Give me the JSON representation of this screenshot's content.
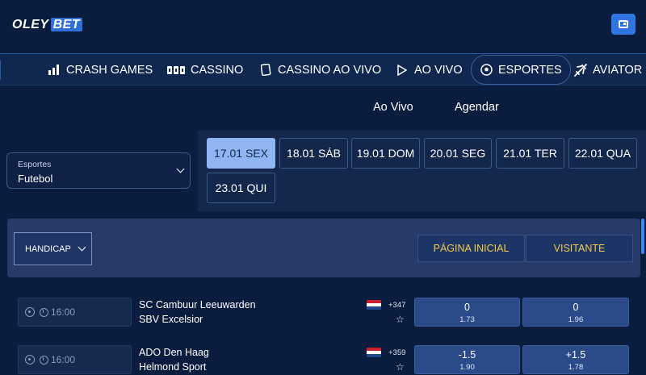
{
  "brand": {
    "logo_main": "OLEY",
    "logo_accent": "BET"
  },
  "icons": {
    "wallet": "wallet-icon",
    "crash_games": "bar-chart-icon",
    "cassino": "slot-reels-icon",
    "cassino_ao_vivo": "playing-card-icon",
    "ao_vivo": "play-icon",
    "esportes": "soccer-ball-icon",
    "aviator": "airplane-icon",
    "dropdown": "chevron-down-icon",
    "match_sport": "soccer-ball-icon",
    "match_time": "clock-icon",
    "favorite": "star-icon",
    "flag": "netherlands-flag-icon"
  },
  "nav": {
    "items": [
      {
        "label": "CRASH GAMES"
      },
      {
        "label": "CASSINO"
      },
      {
        "label": "CASSINO AO VIVO"
      },
      {
        "label": "AO VIVO"
      },
      {
        "label": "ESPORTES",
        "active": true
      },
      {
        "label": "AVIATOR"
      }
    ]
  },
  "subtabs": {
    "live": "Ao Vivo",
    "schedule": "Agendar"
  },
  "filter": {
    "label": "Esportes",
    "value": "Futebol"
  },
  "dates": [
    "17.01 SEX",
    "18.01 SÁB",
    "19.01 DOM",
    "20.01 SEG",
    "21.01 TER",
    "22.01 QUA",
    "23.01 QUI"
  ],
  "market": {
    "selected": "HANDICAP",
    "home_header": "PÁGINA INICIAL",
    "away_header": "VISITANTE"
  },
  "matches": [
    {
      "time": "16:00",
      "home": "SC Cambuur Leeuwarden",
      "away": "SBV Excelsior",
      "more_bets": "+347",
      "home_line": "0",
      "home_odds": "1.73",
      "away_line": "0",
      "away_odds": "1.96"
    },
    {
      "time": "16:00",
      "home": "ADO Den Haag",
      "away": "Helmond Sport",
      "more_bets": "+359",
      "home_line": "-1.5",
      "home_odds": "1.90",
      "away_line": "+1.5",
      "away_odds": "1.78"
    }
  ],
  "colors": {
    "background": "#0b1d3f",
    "accent_blue": "#2f74e0",
    "active_date": "#8fb6f2",
    "header_yellow": "#f2cc4a",
    "odds_button": "#2a4a8a"
  }
}
